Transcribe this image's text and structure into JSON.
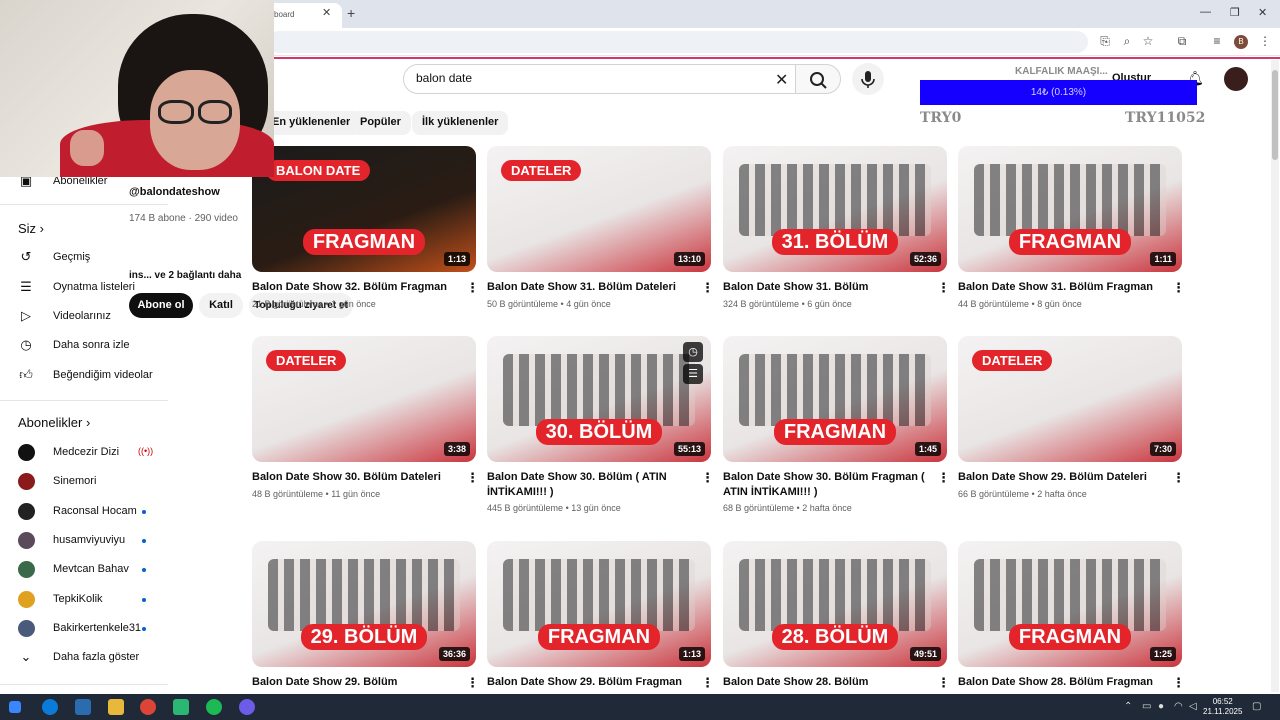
{
  "browser": {
    "tab_title": "board",
    "profile_initial": "B"
  },
  "search": {
    "query": "balon date"
  },
  "header": {
    "create_label": "Oluştur"
  },
  "overlay": {
    "title": "KALFALIK MAAŞI...",
    "progress_text": "14₺ (0.13%)",
    "progress_fraction": 0.0013,
    "bar_color": "#1500ff",
    "left_label": "TRY0",
    "right_label": "TRY11052"
  },
  "chips": [
    {
      "label": "En yüklenenler"
    },
    {
      "label": "Popüler"
    },
    {
      "label": "İlk yüklenenler"
    }
  ],
  "sidebar": {
    "subscriptions_label": "Abonelikler",
    "you_header": "Siz",
    "you_items": [
      {
        "icon": "history-icon",
        "label": "Geçmiş"
      },
      {
        "icon": "playlist-icon",
        "label": "Oynatma listeleri"
      },
      {
        "icon": "your-videos-icon",
        "label": "Videolarınız"
      },
      {
        "icon": "watch-later-icon",
        "label": "Daha sonra izle"
      },
      {
        "icon": "liked-videos-icon",
        "label": "Beğendiğim videolar"
      }
    ],
    "subs_header": "Abonelikler",
    "subs": [
      {
        "name": "Medcezir Dizi",
        "live": true,
        "color": "#111111"
      },
      {
        "name": "Sinemori",
        "live": false,
        "color": "#8b1a1a"
      },
      {
        "name": "Raconsal Hocam",
        "live": false,
        "color": "#222222"
      },
      {
        "name": "husamviyuviyu",
        "live": false,
        "color": "#5a4a5a"
      },
      {
        "name": "Mevtcan Bahav",
        "live": false,
        "color": "#3a6a4a"
      },
      {
        "name": "TepkiKolik",
        "live": false,
        "color": "#e0a020"
      },
      {
        "name": "Bakirkertenkele31",
        "live": false,
        "color": "#4a5a7a"
      }
    ],
    "show_more": "Daha fazla göster"
  },
  "channel_card": {
    "handle": "@balondateshow",
    "stats": "174 B abone · 290 video",
    "links": "ins... ve 2 bağlantı daha",
    "subscribe": "Abone ol",
    "join": "Katıl",
    "community": "Topluluğu ziyaret et"
  },
  "videos": [
    {
      "title": "Balon Date Show 32. Bölüm Fragman",
      "views": "21 B görüntüleme",
      "age": "1 gün önce",
      "duration": "1:13",
      "badge": "BALON DATE",
      "big": "FRAGMAN",
      "style": "dark"
    },
    {
      "title": "Balon Date Show 31. Bölüm Dateleri",
      "views": "50 B görüntüleme",
      "age": "4 gün önce",
      "duration": "13:10",
      "badge": "DATELER",
      "big": "",
      "style": "light"
    },
    {
      "title": "Balon Date Show 31. Bölüm",
      "views": "324 B görüntüleme",
      "age": "6 gün önce",
      "duration": "52:36",
      "badge": "",
      "big": "31. BÖLÜM",
      "style": "people"
    },
    {
      "title": "Balon Date Show 31. Bölüm Fragman",
      "views": "44 B görüntüleme",
      "age": "8 gün önce",
      "duration": "1:11",
      "badge": "",
      "big": "FRAGMAN",
      "style": "people"
    },
    {
      "title": "Balon Date Show 30. Bölüm Dateleri",
      "views": "48 B görüntüleme",
      "age": "11 gün önce",
      "duration": "3:38",
      "badge": "DATELER",
      "big": "",
      "style": "light"
    },
    {
      "title": "Balon Date Show 30. Bölüm ( ATIN İNTİKAMI!!! )",
      "views": "445 B görüntüleme",
      "age": "13 gün önce",
      "duration": "55:13",
      "badge": "",
      "big": "30. BÖLÜM",
      "style": "people"
    },
    {
      "title": "Balon Date Show 30. Bölüm Fragman ( ATIN İNTİKAMI!!! )",
      "views": "68 B görüntüleme",
      "age": "2 hafta önce",
      "duration": "1:45",
      "badge": "",
      "big": "FRAGMAN",
      "style": "people"
    },
    {
      "title": "Balon Date Show 29. Bölüm Dateleri",
      "views": "66 B görüntüleme",
      "age": "2 hafta önce",
      "duration": "7:30",
      "badge": "DATELER",
      "big": "",
      "style": "light"
    },
    {
      "title": "Balon Date Show 29. Bölüm",
      "views": "",
      "age": "",
      "duration": "36:36",
      "badge": "",
      "big": "29. BÖLÜM",
      "style": "people"
    },
    {
      "title": "Balon Date Show 29. Bölüm Fragman",
      "views": "",
      "age": "",
      "duration": "1:13",
      "badge": "",
      "big": "FRAGMAN",
      "style": "people"
    },
    {
      "title": "Balon Date Show 28. Bölüm",
      "views": "",
      "age": "",
      "duration": "49:51",
      "badge": "",
      "big": "28. BÖLÜM",
      "style": "people"
    },
    {
      "title": "Balon Date Show 28. Bölüm Fragman",
      "views": "",
      "age": "",
      "duration": "1:25",
      "badge": "",
      "big": "FRAGMAN",
      "style": "people"
    }
  ],
  "taskbar": {
    "time": "06:52",
    "date": "21.11.2025"
  }
}
